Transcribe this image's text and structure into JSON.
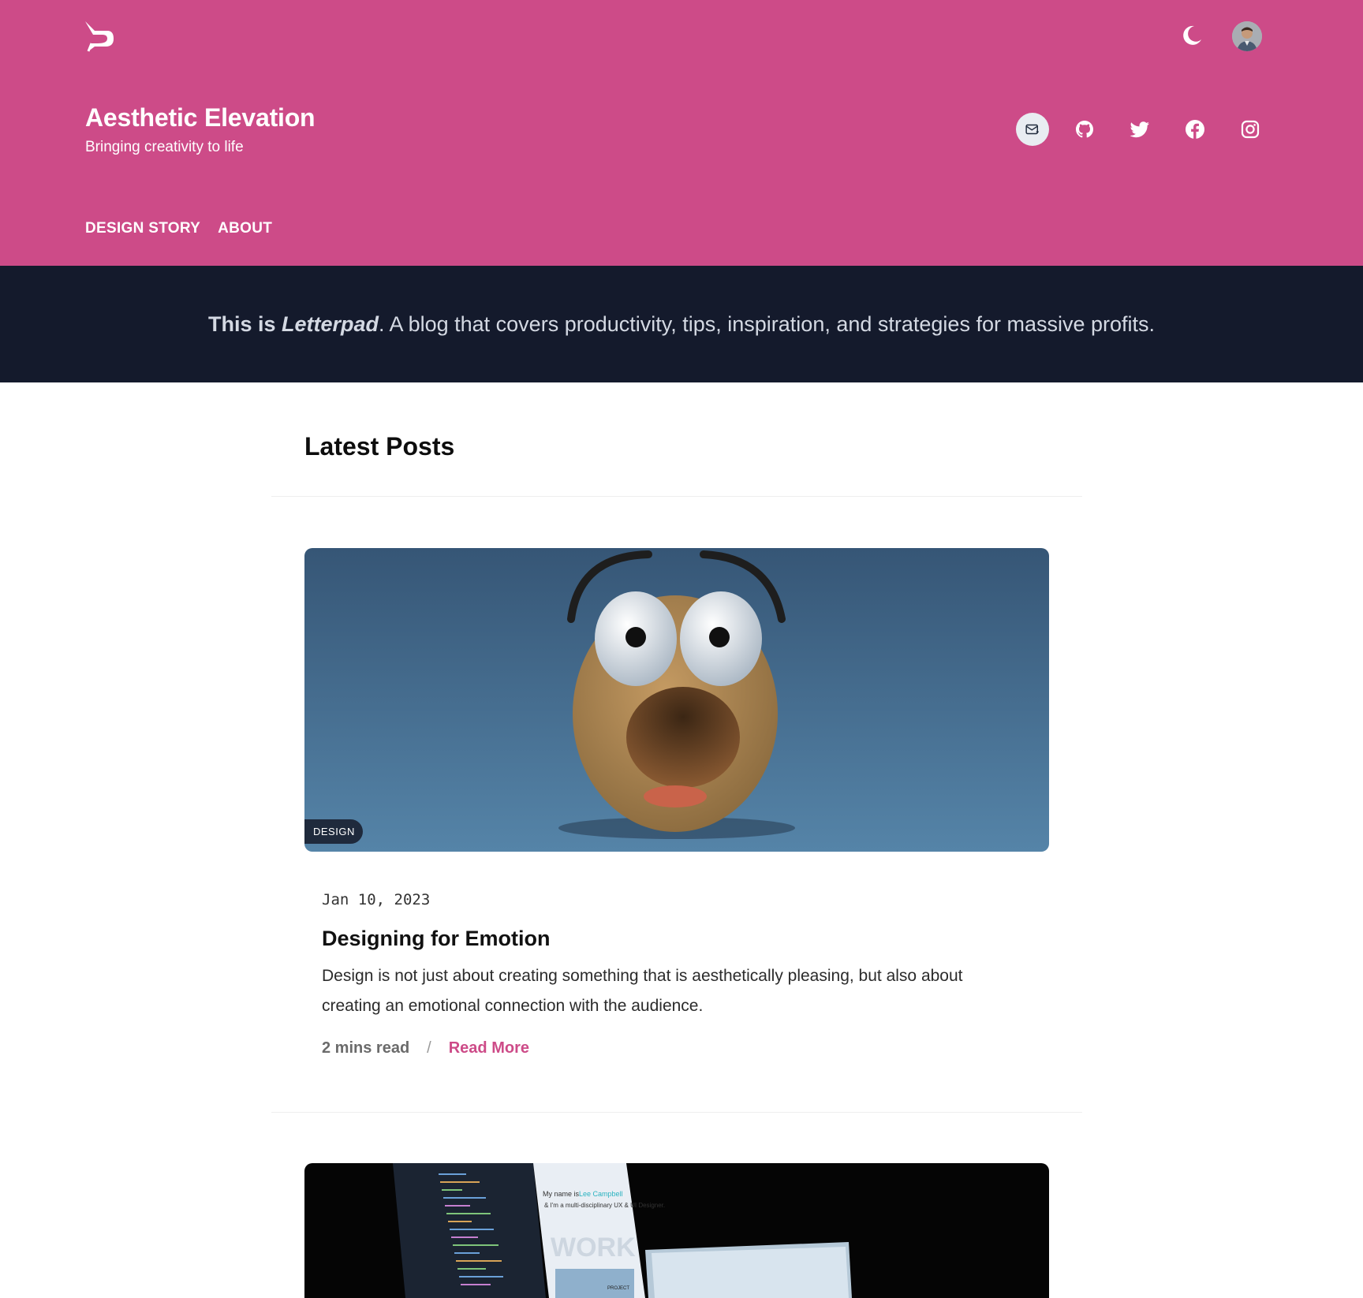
{
  "header": {
    "logo_icon": "letterpad-logo-icon",
    "theme_toggle_icon": "moon-icon",
    "avatar_icon": "user-avatar",
    "site_title": "Aesthetic Elevation",
    "tagline": "Bringing creativity to life",
    "socials": [
      {
        "name": "email",
        "icon": "mail-icon"
      },
      {
        "name": "github",
        "icon": "github-icon"
      },
      {
        "name": "twitter",
        "icon": "twitter-icon"
      },
      {
        "name": "facebook",
        "icon": "facebook-icon"
      },
      {
        "name": "instagram",
        "icon": "instagram-icon"
      }
    ],
    "nav": [
      {
        "label": "DESIGN STORY"
      },
      {
        "label": "ABOUT"
      }
    ]
  },
  "banner": {
    "prefix": "This is ",
    "brand": "Letterpad",
    "text": ". A blog that covers productivity, tips, inspiration, and strategies for massive profits."
  },
  "main": {
    "section_title": "Latest Posts",
    "posts": [
      {
        "tag": "DESIGN",
        "date": "Jan 10, 2023",
        "title": "Designing for Emotion",
        "excerpt": "Design is not just about creating something that is aesthetically pleasing, but also about creating an emotional connection with the audience.",
        "read_time": "2 mins read",
        "separator": "/",
        "read_more": "Read More"
      },
      {
        "image_text_1": "My name is",
        "image_text_2": "Lee Campbell",
        "image_text_3": "& I'm a multi-disciplinary UX & UI Designer.",
        "image_text_4": "WORK",
        "image_text_5": "PROJECT"
      }
    ]
  },
  "colors": {
    "header_bg": "#cd4b88",
    "banner_bg": "#141a2c",
    "accent": "#cd4b88"
  }
}
